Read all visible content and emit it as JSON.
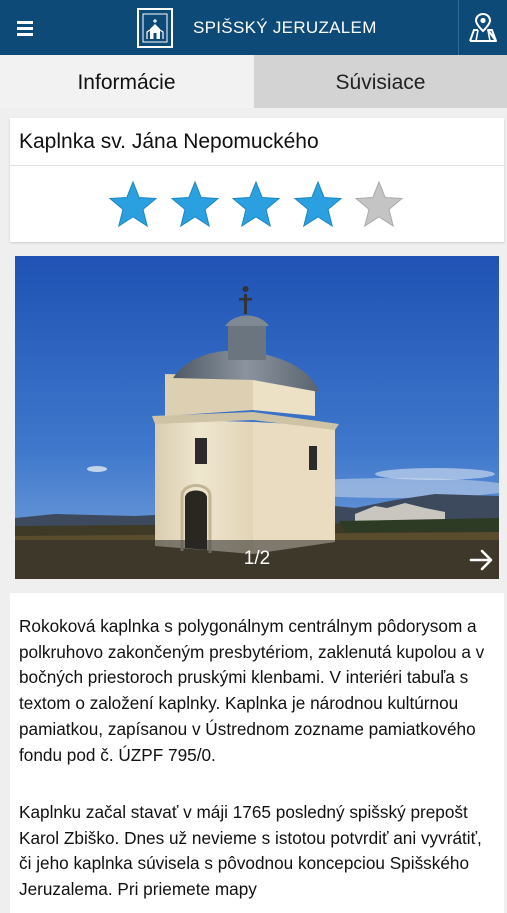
{
  "app": {
    "title": "SPIŠSKÝ JERUZALEM",
    "menu_icon": "hamburger-menu-icon",
    "logo_icon": "church-logo-icon",
    "map_icon": "map-pin-icon"
  },
  "tabs": [
    {
      "label": "Informácie",
      "active": true
    },
    {
      "label": "Súvisiace",
      "active": false
    }
  ],
  "poi": {
    "title": "Kaplnka sv. Jána Nepomuckého",
    "rating": 4,
    "rating_max": 5
  },
  "gallery": {
    "counter": "1/2",
    "current": 1,
    "total": 2,
    "next_icon": "arrow-right-icon"
  },
  "description": {
    "paragraphs": [
      "Rokoková kaplnka s polygonálnym centrálnym pôdorysom a polkruhovo zakončeným presbytériom, zaklenutá kupolou a v bočných priestoroch pruskými klenbami. V interiéri tabuľa s textom o založení kaplnky. Kaplnka je národnou kultúrnou pamiatkou, zapísanou v Ústrednom zozname pamiatkového fondu pod č. ÚZPF 795/0.",
      "Kaplnku začal stavať v máji 1765 posledný spišský prepošt Karol Zbiško. Dnes už nevieme s istotou potvrdiť ani vyvrátiť, či jeho kaplnka súvisela s pôvodnou koncepciou Spišského Jeruzalema. Pri priemete mapy"
    ]
  },
  "colors": {
    "topbar": "#0e4a77",
    "star_filled": "#2aa0e0",
    "star_empty": "#c4c4c4"
  }
}
